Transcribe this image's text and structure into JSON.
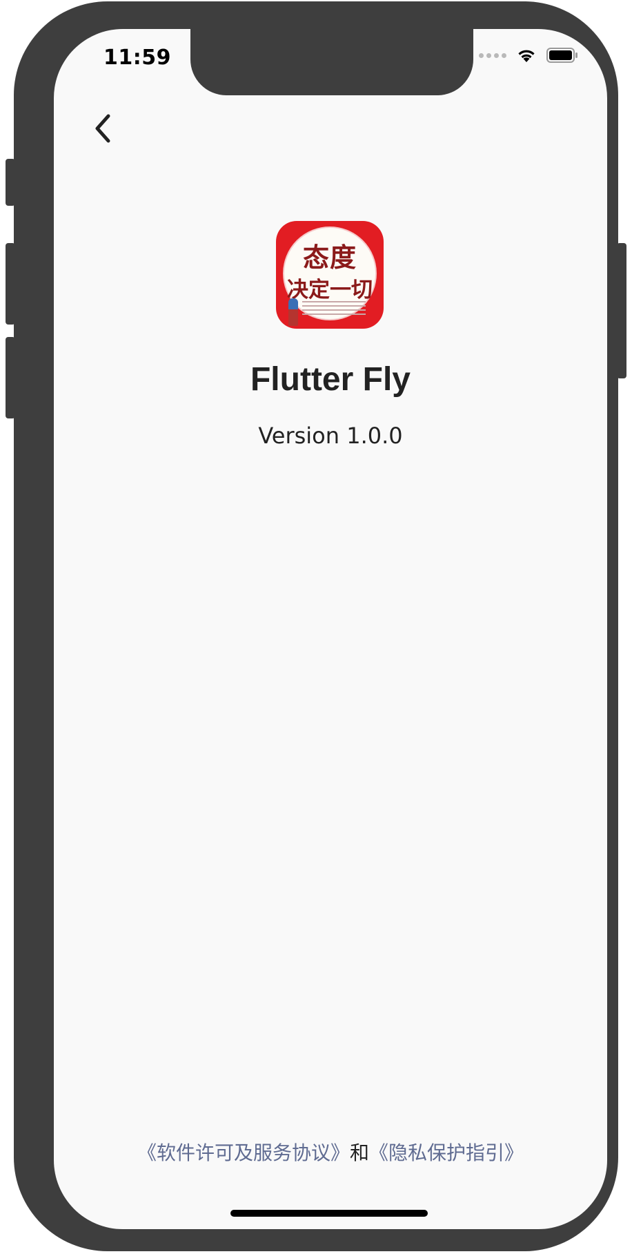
{
  "status_bar": {
    "time": "11:59"
  },
  "nav": {
    "back_icon": "chevron-left-icon"
  },
  "app_icon": {
    "title_line1": "态度",
    "title_line2": "决定一切"
  },
  "app": {
    "name": "Flutter Fly",
    "version": "Version 1.0.0"
  },
  "footer": {
    "license_link": "《软件许可及服务协议》",
    "conjunction": "和",
    "privacy_link": "《隐私保护指引》"
  },
  "colors": {
    "link": "#5f6b91",
    "text": "#222222",
    "background": "#f9f9f9",
    "icon_red": "#e21d23"
  }
}
